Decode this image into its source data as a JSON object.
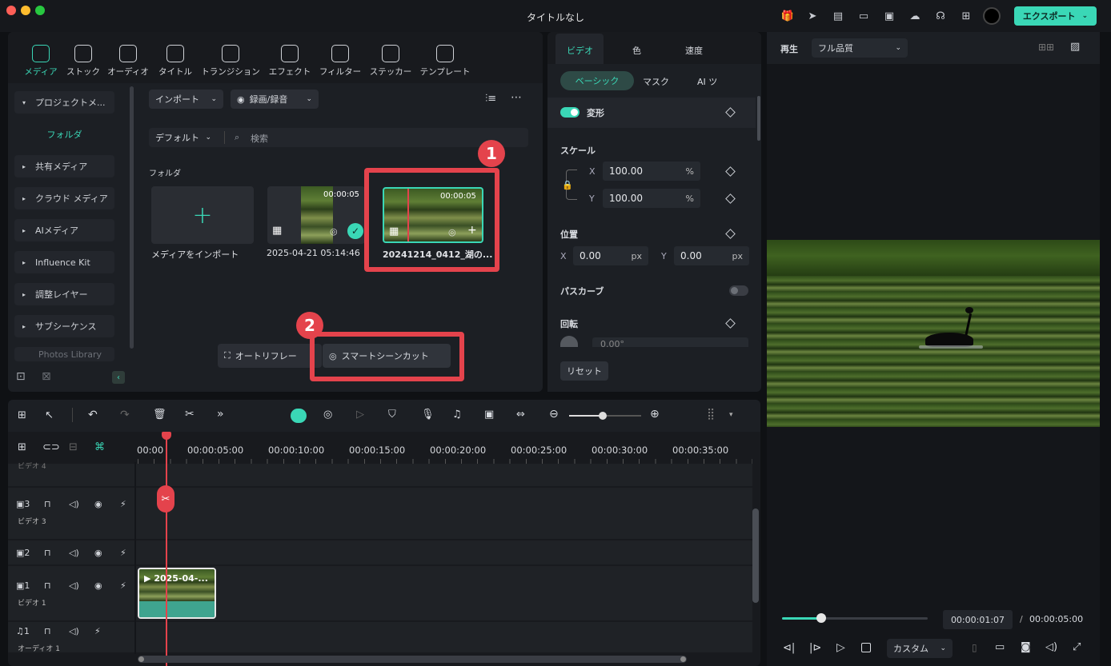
{
  "window": {
    "title": "タイトルなし",
    "export_label": "エクスポート"
  },
  "categories": [
    {
      "label": "メディア",
      "icon": "media-icon"
    },
    {
      "label": "ストック",
      "icon": "stock-icon"
    },
    {
      "label": "オーディオ",
      "icon": "music-icon"
    },
    {
      "label": "タイトル",
      "icon": "title-icon"
    },
    {
      "label": "トランジション",
      "icon": "transition-icon"
    },
    {
      "label": "エフェクト",
      "icon": "effect-icon"
    },
    {
      "label": "フィルター",
      "icon": "filter-icon"
    },
    {
      "label": "ステッカー",
      "icon": "sticker-icon"
    },
    {
      "label": "テンプレート",
      "icon": "template-icon"
    }
  ],
  "sidebar": {
    "project": "プロジェクトメ...",
    "folder": "フォルダ",
    "items": [
      "共有メディア",
      "クラウド メディア",
      "AIメディア",
      "Influence Kit",
      "調整レイヤー",
      "サブシーケンス",
      "Photos Library"
    ]
  },
  "media": {
    "import_label": "インポート",
    "record_label": "録画/録音",
    "sort_label": "デフォルト",
    "search_placeholder": "検索",
    "section_label": "フォルダ",
    "import_tile": "メディアをインポート",
    "clips": [
      {
        "name": "2025-04-21 05:14:46",
        "duration": "00:00:05"
      },
      {
        "name": "20241214_0412_湖の...",
        "duration": "00:00:05"
      }
    ],
    "auto_reframe": "オートリフレー",
    "smart_scene_cut": "スマートシーンカット",
    "callouts": [
      "1",
      "2"
    ]
  },
  "props": {
    "tabs": [
      "ビデオ",
      "色",
      "速度"
    ],
    "subtabs": [
      "ベーシック",
      "マスク",
      "AI ツ"
    ],
    "transform": "変形",
    "scale": "スケール",
    "scale_x": "100.00",
    "scale_y": "100.00",
    "percent": "%",
    "position": "位置",
    "pos_x": "0.00",
    "pos_y": "0.00",
    "px": "px",
    "x": "X",
    "y": "Y",
    "bezier": "パスカーブ",
    "rotation": "回転",
    "rotation_val": "0.00°",
    "reset": "リセット"
  },
  "preview": {
    "play_label": "再生",
    "quality": "フル品質",
    "current_time": "00:00:01:07",
    "separator": "/",
    "total_time": "00:00:05:00",
    "custom": "カスタム",
    "progress": 0.27
  },
  "timeline": {
    "ticks": [
      "00:00",
      "00:00:05:00",
      "00:00:10:00",
      "00:00:15:00",
      "00:00:20:00",
      "00:00:25:00",
      "00:00:30:00",
      "00:00:35:00"
    ],
    "tracks": [
      {
        "num": "3",
        "name": "ビデオ 3"
      },
      {
        "num": "2",
        "name": ""
      },
      {
        "num": "1",
        "name": "ビデオ 1"
      },
      {
        "num": "1",
        "name": "オーディオ 1"
      }
    ],
    "track4_partial": "ビデオ 4",
    "clip_label": "2025-04-..."
  }
}
